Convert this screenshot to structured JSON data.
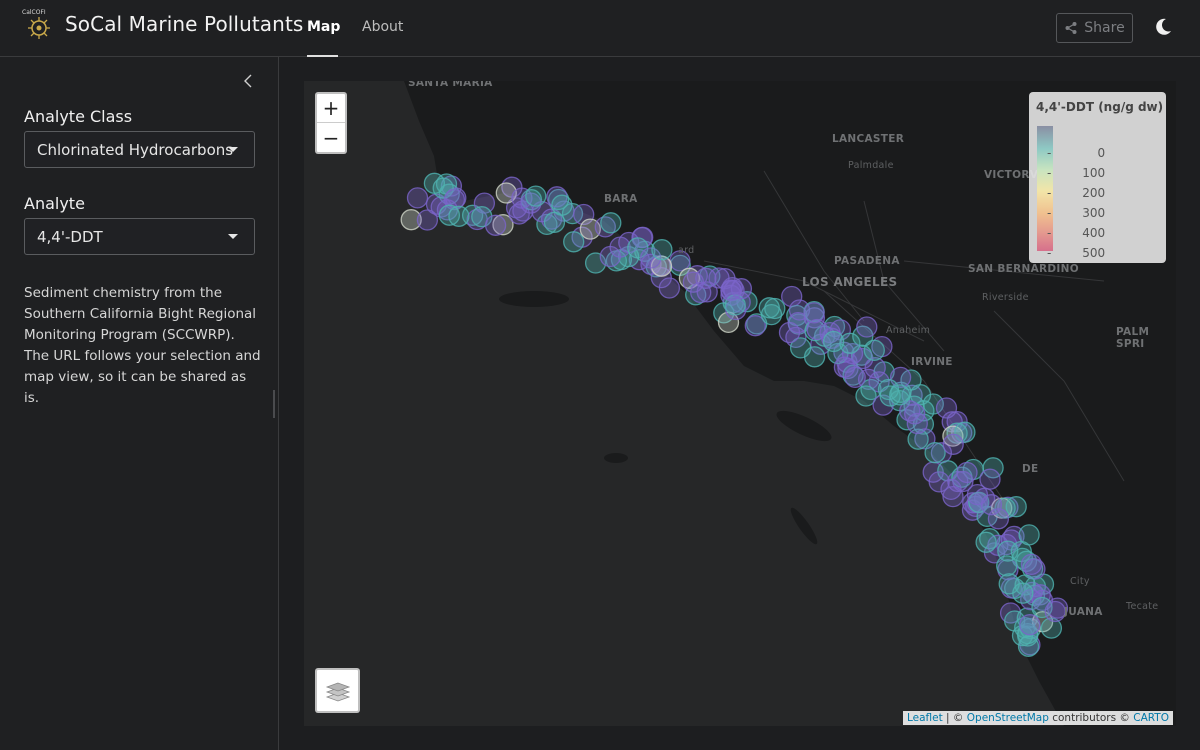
{
  "header": {
    "logo_text": "CalCOFI",
    "title": "SoCal Marine Pollutants",
    "nav": [
      {
        "label": "Map",
        "active": true
      },
      {
        "label": "About",
        "active": false
      }
    ],
    "share_label": "Share",
    "theme_icon": "moon-icon"
  },
  "sidebar": {
    "analyte_class_label": "Analyte Class",
    "analyte_class_value": "Chlorinated Hydrocarbons",
    "analyte_label": "Analyte",
    "analyte_value": "4,4'-DDT",
    "description": "Sediment chemistry from the Southern California Bight Regional Monitoring Program (SCCWRP). The URL follows your selection and map view, so it can be shared as is."
  },
  "map": {
    "zoom_in": "+",
    "zoom_out": "−",
    "legend": {
      "title": "4,4'-DDT (ng/g dw)",
      "ticks": [
        "0",
        "100",
        "200",
        "300",
        "400",
        "500"
      ]
    },
    "attribution": {
      "leaflet": "Leaflet",
      "sep": " | © ",
      "osm": "OpenStreetMap",
      "contrib": " contributors © ",
      "carto": "CARTO"
    },
    "places": [
      "SANTA MARIA",
      "LANCASTER",
      "Palmdale",
      "VICTORV",
      "PASADENA",
      "LOS ANGELES",
      "SAN BERNARDINO",
      "Riverside",
      "Anaheim",
      "IRVINE",
      "PALM SPRI",
      "City",
      "JUANA",
      "Tecate",
      "ard",
      "BARA",
      "DE"
    ],
    "colors": {
      "purple": "#7a64c9",
      "teal": "#4fb3b0",
      "light": "#cfd6c8"
    }
  }
}
